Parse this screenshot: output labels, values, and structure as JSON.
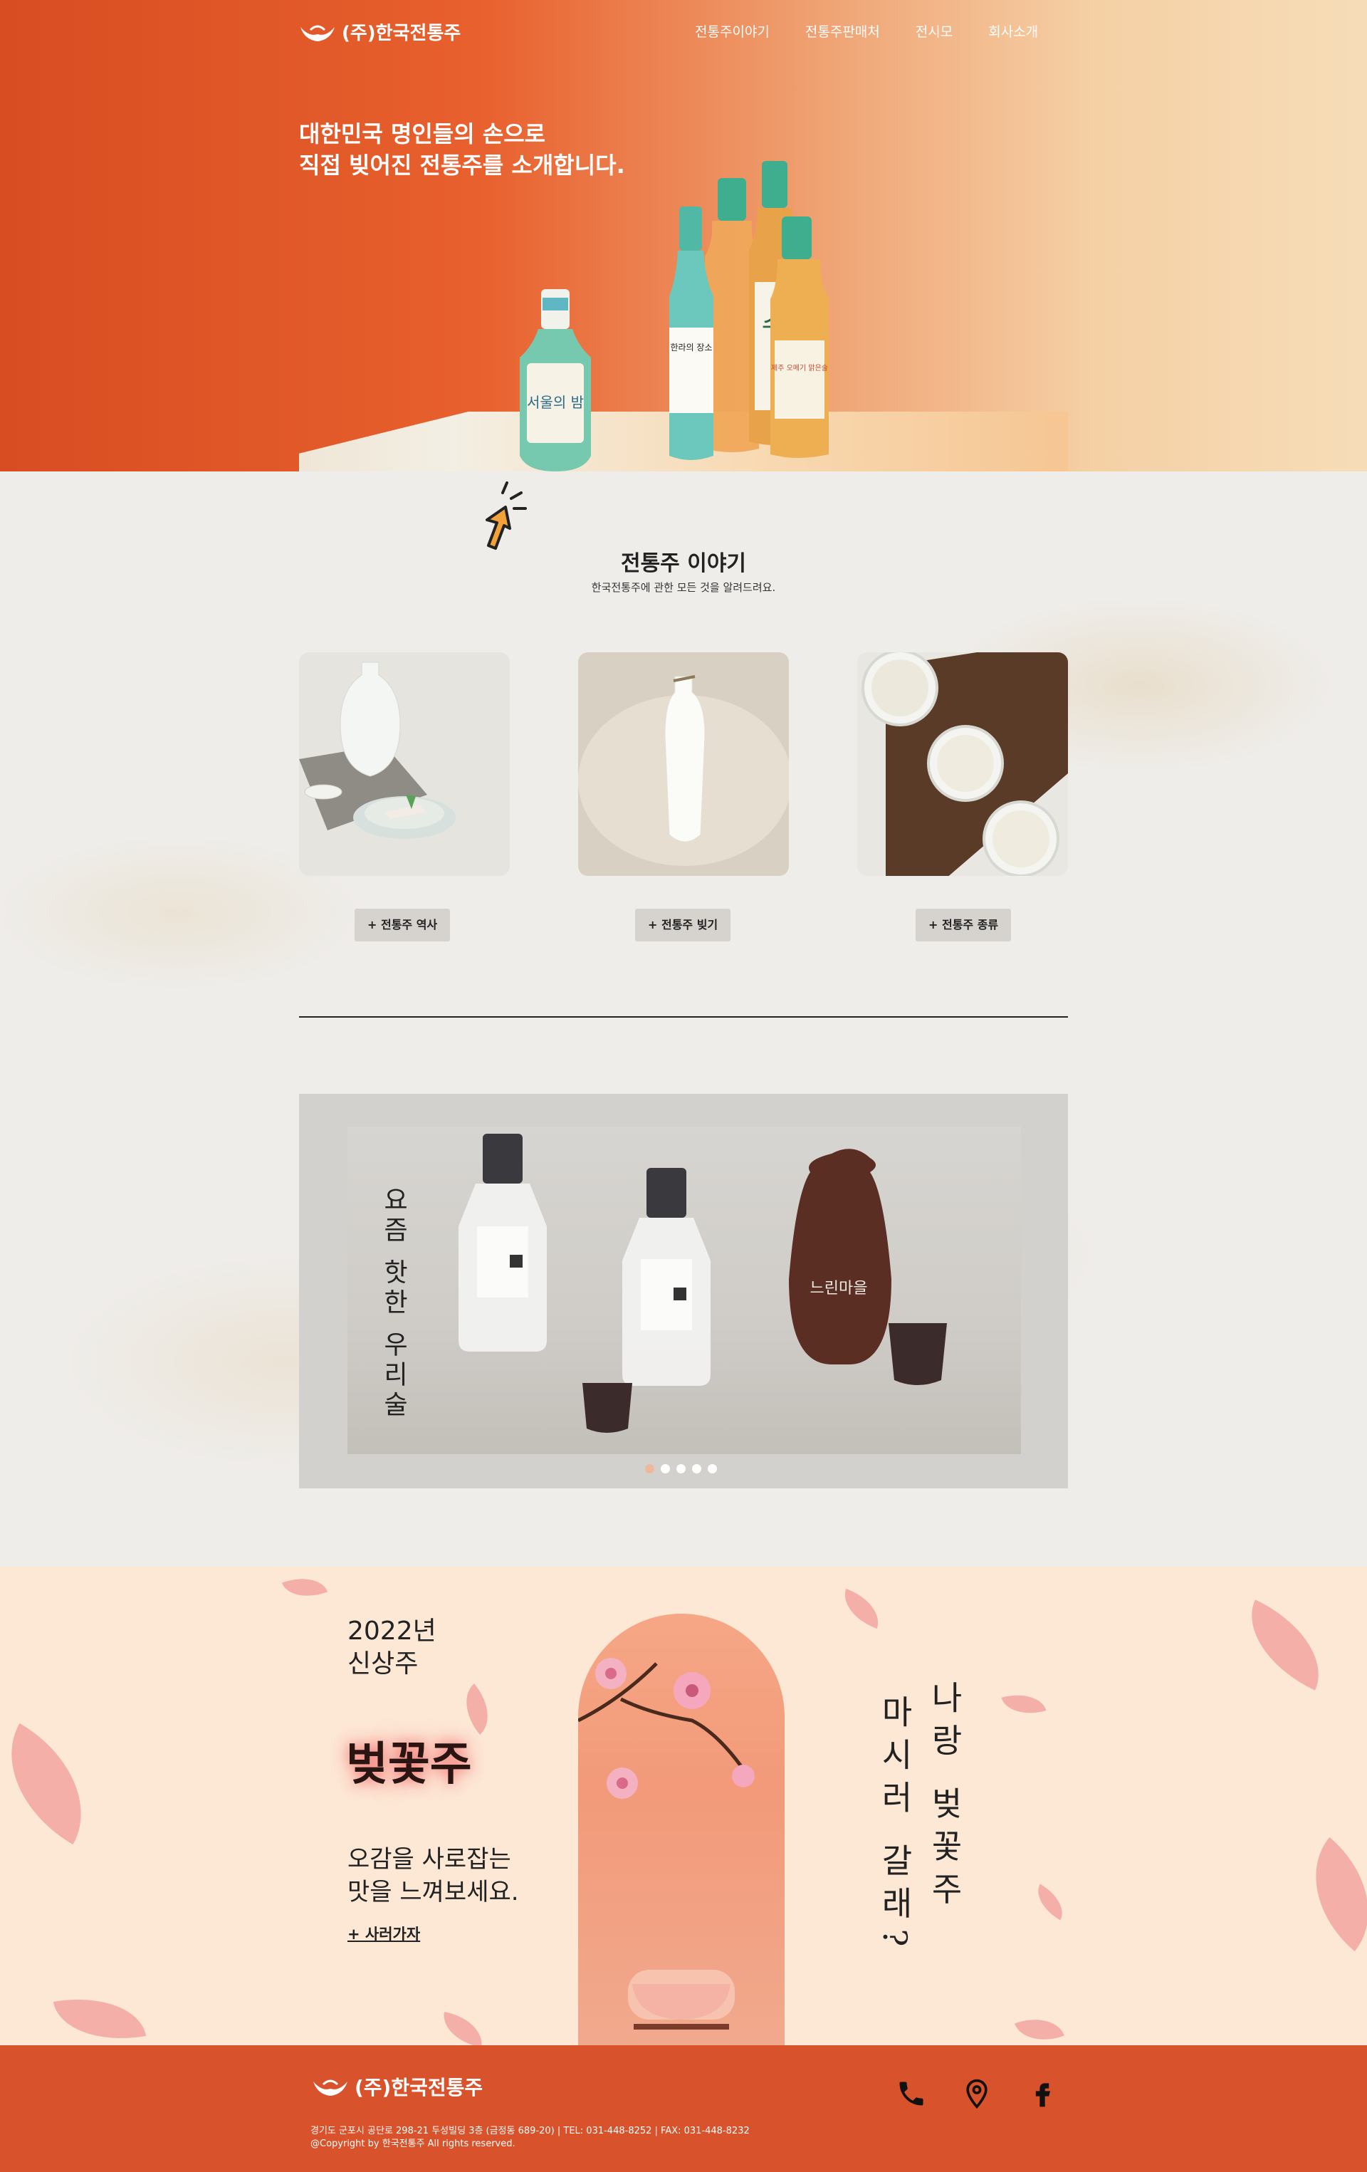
{
  "brand": {
    "logo_text": "(주)한국전통주"
  },
  "nav": {
    "items": [
      "전통주이야기",
      "전통주판매처",
      "전시모",
      "회사소개"
    ]
  },
  "hero": {
    "headline_line1": "대한민국 명인들의 손으로",
    "headline_line2": "직접 빚어진 전통주를 소개합니다.",
    "bottle_labels": [
      "서울의 밤",
      "한라의 장소",
      "수",
      "제주 오메기 맑은술"
    ]
  },
  "story": {
    "title": "전통주 이야기",
    "subtitle": "한국전통주에 관한 모든 것을 알려드려요.",
    "cards": [
      {
        "button": "+ 전통주 역사"
      },
      {
        "button": "+ 전통주 빚기"
      },
      {
        "button": "+ 전통주 종류"
      }
    ]
  },
  "slider": {
    "title": "요즘 핫한 우리술",
    "jar_label": "느린마을",
    "dots": 5,
    "active_dot": 1
  },
  "promo": {
    "year_line1": "2022년",
    "year_line2": "신상주",
    "product": "벚꽃주",
    "taste_line1": "오감을 사로잡는",
    "taste_line2": "맛을 느껴보세요.",
    "buy_link": "+ 사러가자",
    "vertical_right": "나랑 벚꽃주",
    "vertical_left": "마시러 갈래?"
  },
  "footer": {
    "logo_text": "(주)한국전통주",
    "address": "경기도 군포시 공단로 298-21 두성빌딩 3층 (금정동 689-20) | TEL: 031-448-8252 | FAX: 031-448-8232",
    "copyright": "@Copyright by 한국전통주 All rights reserved.",
    "icons": [
      "phone-icon",
      "location-icon",
      "facebook-icon"
    ]
  },
  "colors": {
    "accent": "#d8532b",
    "hero_gradient_light": "#f6ddb8",
    "promo_bg": "#fde8d6",
    "story_bg": "#efedea"
  }
}
